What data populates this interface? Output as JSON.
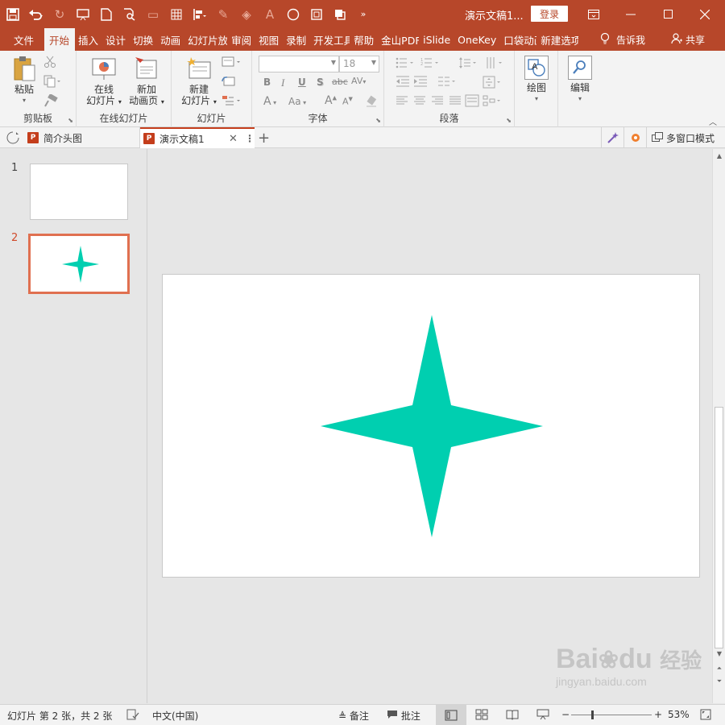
{
  "titlebar": {
    "doc_title": "演示文稿1...",
    "login_label": "登录",
    "icons": [
      "save-icon",
      "undo-icon",
      "redo-icon",
      "present-icon",
      "new-file-icon",
      "print-preview-icon",
      "image-icon",
      "grid-icon",
      "align-icon",
      "pen-icon",
      "fill-icon",
      "font-color-icon",
      "circle-icon",
      "crop-icon",
      "arrange-icon",
      "more-icon"
    ]
  },
  "tabs": [
    {
      "label": "文件"
    },
    {
      "label": "开始"
    },
    {
      "label": "插入"
    },
    {
      "label": "设计"
    },
    {
      "label": "切换"
    },
    {
      "label": "动画"
    },
    {
      "label": "幻灯片放"
    },
    {
      "label": "审阅"
    },
    {
      "label": "视图"
    },
    {
      "label": "录制"
    },
    {
      "label": "开发工具"
    },
    {
      "label": "帮助"
    },
    {
      "label": "金山PDF"
    },
    {
      "label": "iSlide"
    },
    {
      "label": "OneKey"
    },
    {
      "label": "口袋动画"
    },
    {
      "label": "新建选项"
    }
  ],
  "tabbar_right": {
    "tell_me": "告诉我",
    "share": "共享"
  },
  "ribbon": {
    "clipboard": {
      "paste": "粘贴",
      "label": "剪贴板"
    },
    "online": {
      "btn1_line1": "在线",
      "btn1_line2": "幻灯片",
      "btn2_line1": "新加",
      "btn2_line2": "动画页",
      "label": "在线幻灯片"
    },
    "slides": {
      "new_line1": "新建",
      "new_line2": "幻灯片",
      "label": "幻灯片"
    },
    "font": {
      "font_name": "",
      "font_size": "18",
      "bold": "B",
      "italic": "I",
      "underline": "U",
      "shadow": "S",
      "strike": "abc",
      "spacing": "AV",
      "fontcolor": "A",
      "case": "Aa",
      "grow": "A",
      "shrink": "A",
      "label": "字体"
    },
    "paragraph": {
      "label": "段落"
    },
    "drawing": {
      "label": "绘图"
    },
    "editing": {
      "label": "编辑"
    }
  },
  "doctabs": {
    "tab1": "简介头图",
    "tab2": "演示文稿1",
    "ppt_letter": "P",
    "multi_window": "多窗口模式"
  },
  "thumbnails": [
    {
      "number": "1"
    },
    {
      "number": "2"
    }
  ],
  "slide": {
    "shape": "four-point-star",
    "color": "#00cfb0"
  },
  "status": {
    "slide_info": "幻灯片 第 2 张，共 2 张",
    "language": "中文(中国)",
    "notes": "备注",
    "comments": "批注",
    "zoom": "53%",
    "zoom_fraction": 0.53,
    "minus": "−",
    "plus": "+"
  },
  "colors": {
    "accent": "#b7472a",
    "star": "#00cfb0",
    "selected_thumb_border": "#e07050"
  },
  "watermark": {
    "brand": "Bai",
    "brand2": "du",
    "cn": "经验",
    "url": "jingyan.baidu.com"
  }
}
